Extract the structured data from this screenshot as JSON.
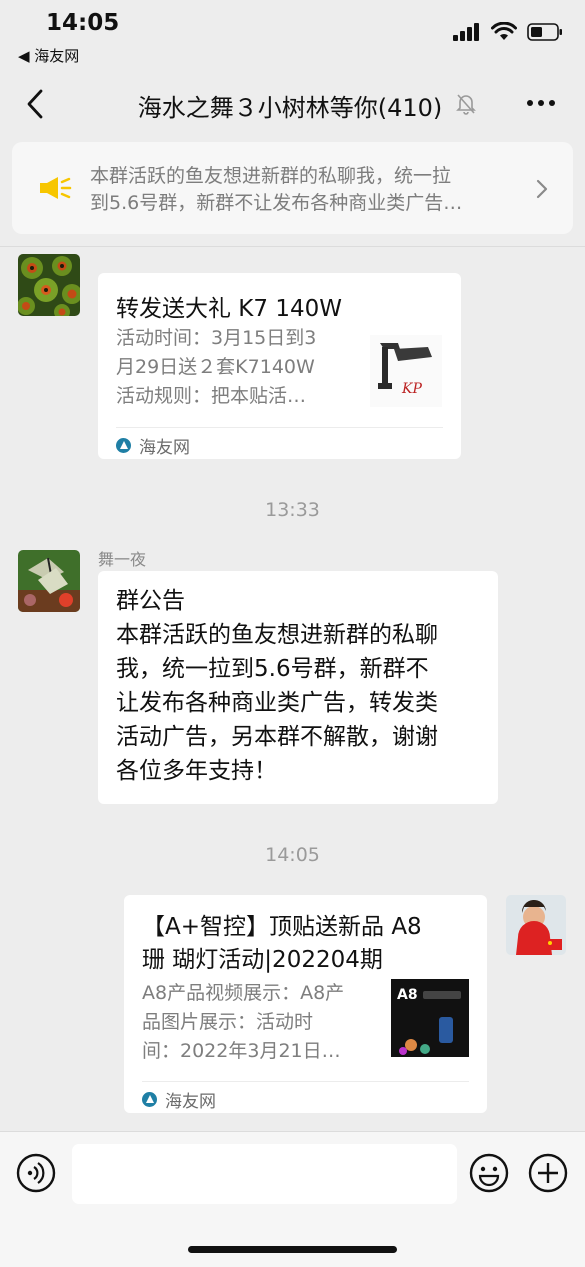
{
  "status_bar": {
    "time": "14:05",
    "back_app": "◀ 海友网"
  },
  "header": {
    "title": "海水之舞３小树林等你(410)",
    "back_icon": "chevron-left-icon",
    "mute_icon": "bell-muted-icon",
    "more_icon": "more-dots-icon"
  },
  "notice": {
    "icon": "megaphone-icon",
    "line1": "本群活跃的鱼友想进新群的私聊我，统一拉",
    "line2": "到5.6号群，新群不让发布各种商业类广告…"
  },
  "messages": [
    {
      "type": "link-card",
      "title": "转发送大礼  K7 140W",
      "desc_lines": [
        "活动时间：3月15日到3",
        "月29日送２套K7140W",
        "活动规则：把本贴活…"
      ],
      "source": "海友网",
      "thumb_brand": "KP"
    },
    {
      "type": "time",
      "text": "13:33"
    },
    {
      "type": "text",
      "sender": "舞一夜",
      "lines": [
        "群公告",
        "本群活跃的鱼友想进新群的私聊",
        "我，统一拉到5.6号群，新群不",
        "让发布各种商业类广告，转发类",
        "活动广告，另本群不解散，谢谢",
        "各位多年支持！"
      ]
    },
    {
      "type": "time",
      "text": "14:05"
    },
    {
      "type": "link-card",
      "title_lines": [
        "【A+智控】顶贴送新品 A8",
        "珊 瑚灯活动|202204期"
      ],
      "desc_lines": [
        "A8产品视频展示：A8产",
        "品图片展示：活动时",
        "间：2022年3月21日…"
      ],
      "source": "海友网",
      "thumb_brand": "A8"
    }
  ],
  "colors": {
    "background": "#ededed",
    "bubble": "#ffffff",
    "notice_icon": "#f7c600",
    "source_icon": "#1f7fa5"
  },
  "input_bar": {
    "voice_icon": "voice-icon",
    "emoji_icon": "emoji-icon",
    "plus_icon": "plus-icon",
    "value": ""
  }
}
